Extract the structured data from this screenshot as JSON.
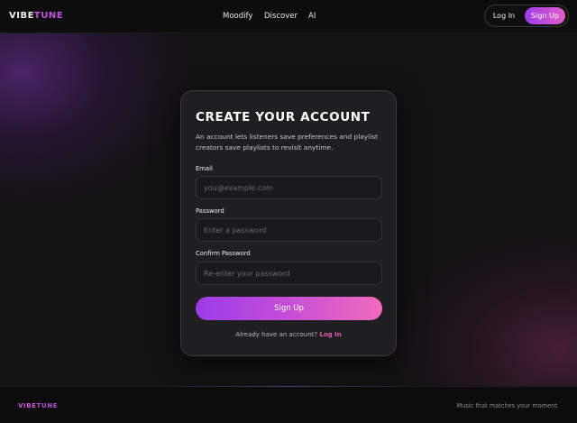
{
  "header": {
    "logo_part1": "VIBE",
    "logo_part2": "TUNE",
    "nav": [
      "Moodify",
      "Discover",
      "AI"
    ],
    "login_label": "Log In",
    "signup_label": "Sign Up"
  },
  "form": {
    "title": "CREATE YOUR ACCOUNT",
    "description": "An account lets listeners save preferences and playlist creators save playlists to revisit anytime.",
    "fields": [
      {
        "label": "Email",
        "placeholder": "you@example.com",
        "value": ""
      },
      {
        "label": "Password",
        "placeholder": "Enter a password",
        "value": ""
      },
      {
        "label": "Confirm Password",
        "placeholder": "Re-enter your password",
        "value": ""
      }
    ],
    "submit_label": "Sign Up",
    "already_text": "Already have an account?",
    "login_link": "Log In"
  },
  "footer": {
    "logo_part1": "VIBE",
    "logo_part2": "TUNE",
    "tagline": "Music that matches your moment."
  },
  "colors": {
    "background": "#131213",
    "accent_purple": "#9b3ce9",
    "accent_pink": "#f06bbc",
    "card": "#1f1e20"
  }
}
